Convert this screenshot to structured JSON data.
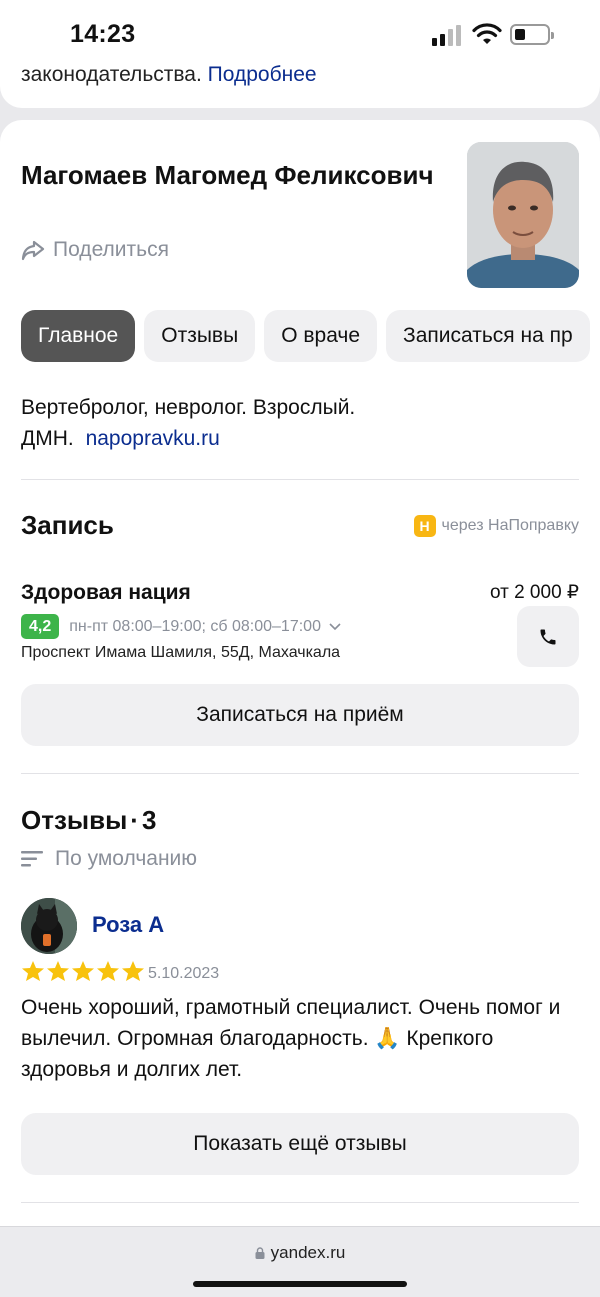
{
  "status_bar": {
    "time": "14:23"
  },
  "top_card": {
    "text": "законодательства.",
    "link": "Подробнее"
  },
  "doctor": {
    "name": "Магомаев Магомед Феликсович",
    "share_label": "Поделиться",
    "photo_icon": "doctor-photo"
  },
  "tabs": [
    {
      "label": "Главное",
      "active": true
    },
    {
      "label": "Отзывы"
    },
    {
      "label": "О враче"
    },
    {
      "label": "Записаться на пр"
    }
  ],
  "specialty": {
    "line1": "Вертебролог, невролог. Взрослый.",
    "line2": "ДМН.",
    "link": "napopravku.ru"
  },
  "booking": {
    "title": "Запись",
    "via_badge": "Н",
    "via_text": "через НаПоправку",
    "clinic_name": "Здоровая нация",
    "price": "от 2 000 ₽",
    "rating": "4,2",
    "hours": "пн-пт 08:00–19:00; сб 08:00–17:00",
    "address": "Проспект Имама Шамиля, 55Д, Махачкала",
    "book_button": "Записаться на приём"
  },
  "reviews": {
    "title": "Отзывы",
    "count": "3",
    "sort_label": "По умолчанию",
    "items": [
      {
        "author": "Роза А",
        "stars": 5,
        "date": "5.10.2023",
        "text": "Очень хороший, грамотный специалист. Очень помог и вылечил. Огромная благодарность. 🙏 Крепкого здоровья и долгих лет."
      }
    ],
    "more_button": "Показать ещё отзывы"
  },
  "browser": {
    "url": "yandex.ru"
  },
  "colors": {
    "link": "#0b2d8f",
    "rating_green": "#3db44a",
    "star": "#f8c20d",
    "napopravku": "#f8b613"
  }
}
